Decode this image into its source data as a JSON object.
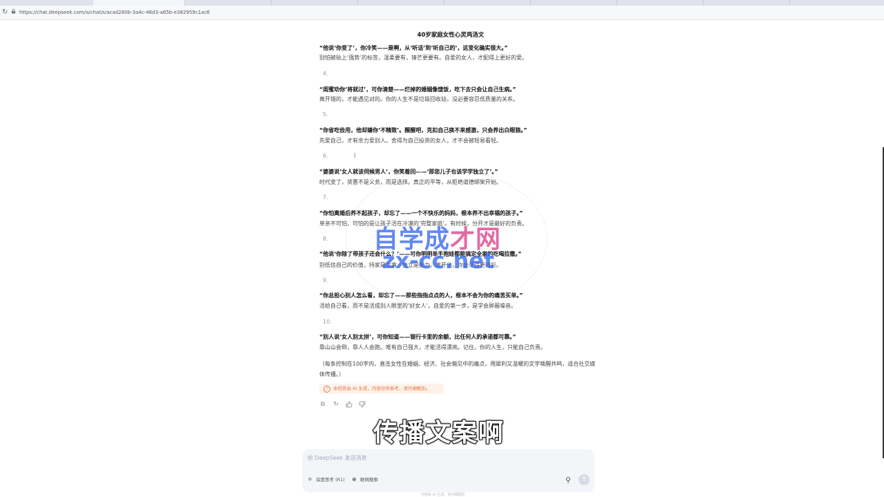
{
  "browser": {
    "url": "https://chat.deepseek.com/a/chat/s/acad280b-3a4c-46d3-a65b-e382959c1ac6"
  },
  "conversation": {
    "title": "40岁家庭女性心灵鸡汤文",
    "lines": [
      {
        "kind": "quote",
        "text": "“他说‘你变了’，你冷笑——是啊，从‘听话’到‘听自己的’，这变化确实很大。”"
      },
      {
        "kind": "body",
        "text": "别怕被贴上‘强势’的标签，温柔要有，锋芒更要有。自爱的女人，才配得上更好的爱。"
      },
      {
        "kind": "num",
        "text": "4."
      },
      {
        "kind": "quote",
        "text": "“闺蜜劝你‘将就过’，可你清楚——烂掉的婚姻像馊饭，吃下去只会让自己生病。”"
      },
      {
        "kind": "body",
        "text": "离开错的，才能遇见对的。你的人生不是垃圾回收站，没必要容忍低质量的关系。"
      },
      {
        "kind": "num",
        "text": "5."
      },
      {
        "kind": "quote",
        "text": "“你省吃俭用，他却嫌你‘不精致’。醒醒吧，克扣自己换不来感激，只会养出白眼狼。”"
      },
      {
        "kind": "body",
        "text": "先爱自己，才有余力爱别人。舍得为自己投资的女人，才不会被轻易看轻。"
      },
      {
        "kind": "num",
        "text": "6."
      },
      {
        "kind": "quote",
        "text": "“婆婆说‘女人就该伺候男人’，你笑着回——‘那您儿子也该学学独立了’。”"
      },
      {
        "kind": "body",
        "text": "时代变了，贤惠不是义务，而是选择。真正的平等，从拒绝道德绑架开始。"
      },
      {
        "kind": "num",
        "text": "7."
      },
      {
        "kind": "quote",
        "text": "“你怕离婚后养不起孩子，却忘了——一个不快乐的妈妈，根本养不出幸福的孩子。”"
      },
      {
        "kind": "body",
        "text": "单亲不可怕，可怕的是让孩子活在冷漠的‘完整家庭’。有时候，分开才是最好的负责。"
      },
      {
        "kind": "num",
        "text": "8."
      },
      {
        "kind": "quote",
        "text": "“他说‘你除了带孩子还会什么？’——可你明明单手抱娃都能搞定全家的吃喝拉撒。”"
      },
      {
        "kind": "body",
        "text": "别低估自己的价值，持家是本事，独立是能力，离开他，你会活得更精彩。"
      },
      {
        "kind": "num",
        "text": "9."
      },
      {
        "kind": "quote",
        "text": "“你总担心别人怎么看，却忘了——那些指指点点的人，根本不会为你的痛苦买单。”"
      },
      {
        "kind": "body",
        "text": "活给自己看，而不是活成别人眼里的‘好女人’。自爱的第一步，是学会屏蔽噪音。"
      },
      {
        "kind": "num",
        "text": "10."
      },
      {
        "kind": "quote",
        "text": "“别人说‘女人别太拼’，可你知道——银行卡里的余额，比任何人的承诺都可靠。”"
      },
      {
        "kind": "body",
        "text": "靠山山会倒，靠人人会跑。唯有自己强大，才能活得漂亮。记住，你的人生，只能自己负责。"
      }
    ],
    "note": "（每条控制在100字内，直击女性在婚姻、经济、社会偏见中的痛点，用犀利又温暖的文字唤醒共鸣，适合社交媒体传播。）",
    "disclaimer": "本回答由 AI 生成，内容仅供参考，请仔细甄别。"
  },
  "watermark": {
    "line1_a": "自学成",
    "line1_b": "才网",
    "line2": "zx-cc.net"
  },
  "subtitle": "传播文案啊",
  "composer": {
    "placeholder": "给 DeepSeek 发送消息",
    "deep_think_label": "深度思考 (R1)",
    "search_label": "联网搜索"
  },
  "footer": "内容由 AI 生成，请仔细甄别"
}
